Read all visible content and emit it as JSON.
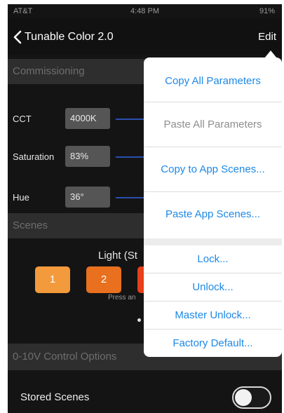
{
  "status_bar": {
    "carrier": "AT&T",
    "time": "4:48 PM",
    "battery": "91%"
  },
  "nav": {
    "back_label": "Tunable Color 2.0",
    "edit_label": "Edit"
  },
  "sections": {
    "commissioning": "Commissioning",
    "scenes": "Scenes",
    "control_options": "0-10V Control Options"
  },
  "params": [
    {
      "label": "CCT",
      "value": "4000K"
    },
    {
      "label": "Saturation",
      "value": "83%"
    },
    {
      "label": "Hue",
      "value": "36°"
    }
  ],
  "scenes": {
    "light_label": "Light (St",
    "press_text": "Press an",
    "buttons": [
      "1",
      "2"
    ]
  },
  "stored_scenes": {
    "label": "Stored Scenes",
    "enabled": false
  },
  "menu": {
    "items": [
      "Copy All Parameters",
      "Paste All Parameters",
      "Copy to App Scenes...",
      "Paste App Scenes...",
      "Lock...",
      "Unlock...",
      "Master Unlock...",
      "Factory Default..."
    ]
  },
  "colors": {
    "accent": "#1e88e5",
    "scene_button_1": "#f39a3c",
    "scene_button_2": "#e8701e",
    "scene_button_3": "#e8401a",
    "slider": "#2a4fb0"
  }
}
